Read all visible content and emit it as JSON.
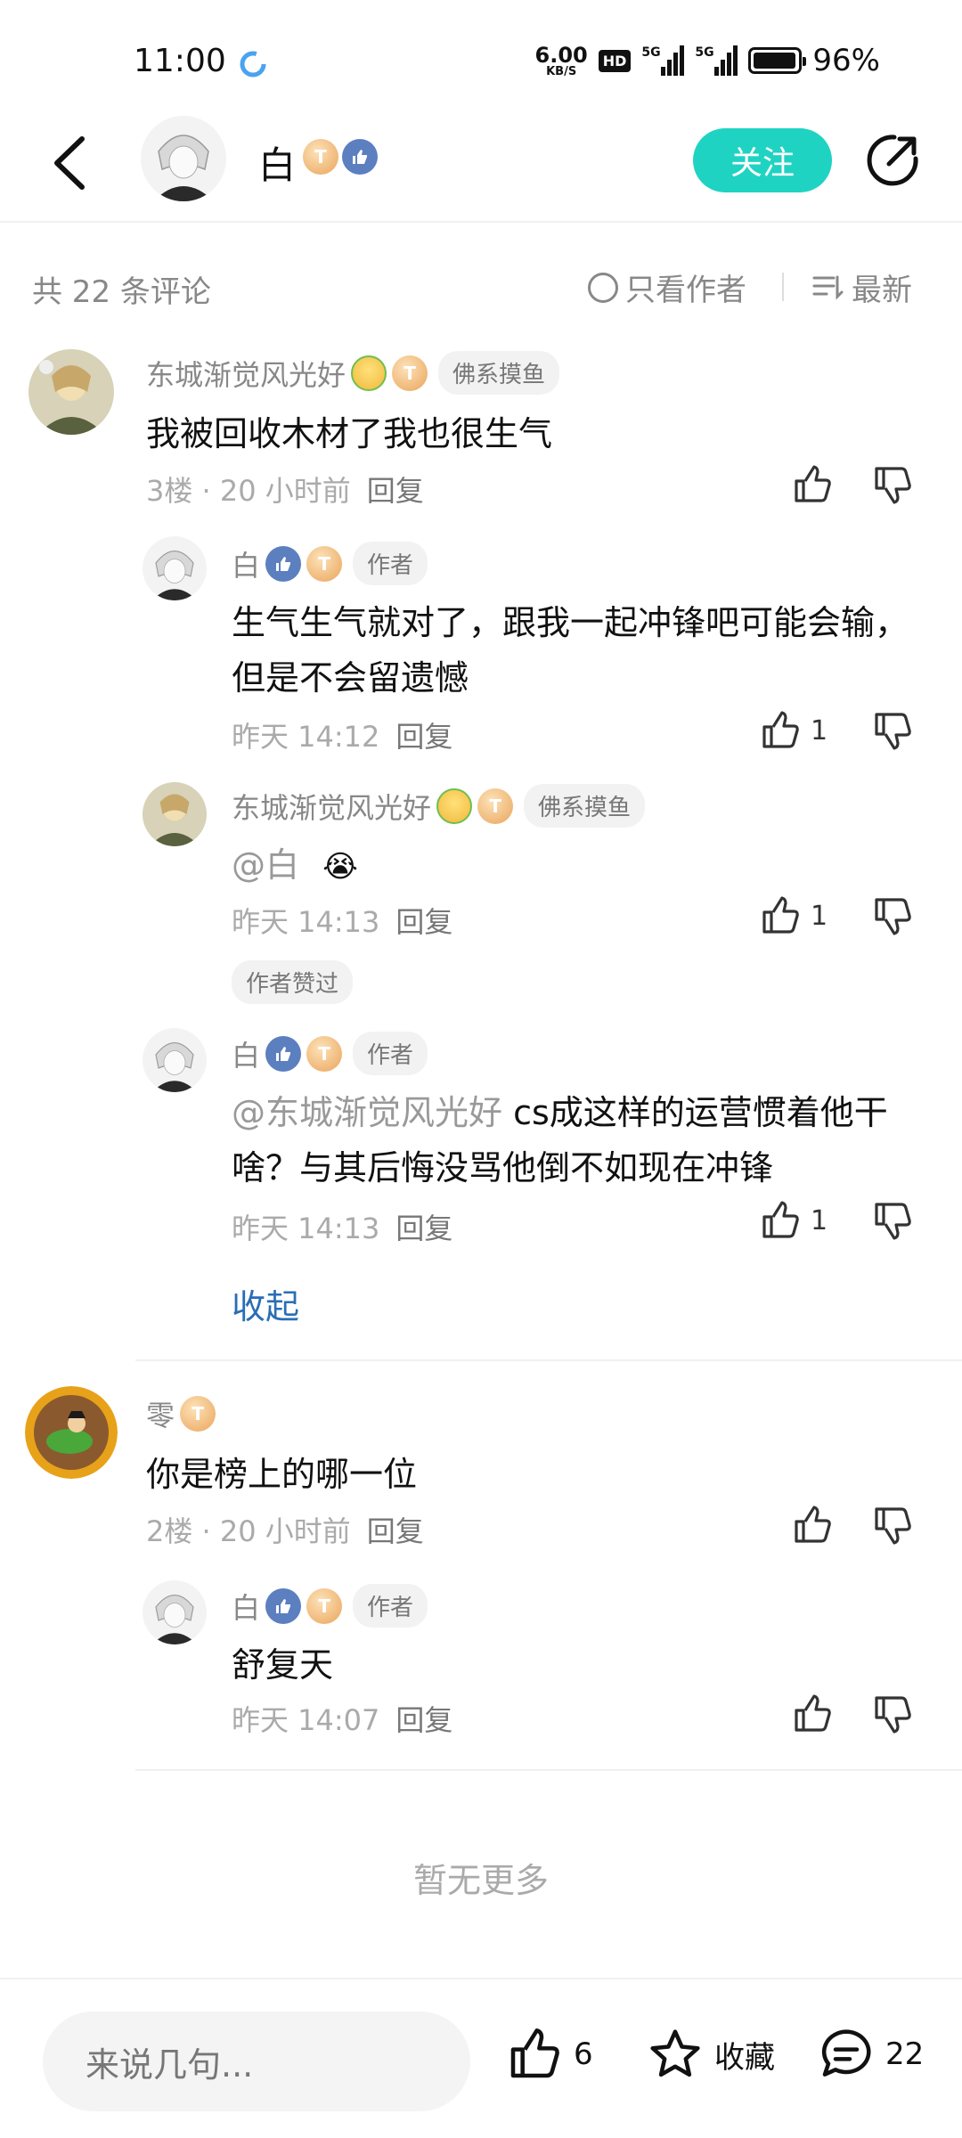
{
  "status": {
    "time": "11:00",
    "net_speed": "6.00",
    "net_unit": "KB/S",
    "hd": "HD",
    "sig1": "5G",
    "sig2": "5G",
    "battery": "96%",
    "battery_level": 0.96
  },
  "header": {
    "name": "白",
    "follow_label": "关注"
  },
  "comments_bar": {
    "count_label": "共 22 条评论",
    "only_author_label": "只看作者",
    "sort_label": "最新"
  },
  "comments": [
    {
      "user": "东城渐觉风光好",
      "level": "5",
      "tag": "佛系摸鱼",
      "text": "我被回收木材了我也很生气",
      "floor": "3楼 · 20 小时前",
      "reply": "回复",
      "replies": [
        {
          "user": "白",
          "level": "4",
          "tag": "作者",
          "text": "生气生气就对了，跟我一起冲锋吧可能会输，但是不会留遗憾",
          "time": "昨天 14:12",
          "reply": "回复",
          "likes": "1"
        },
        {
          "user": "东城渐觉风光好",
          "level": "5",
          "tag": "佛系摸鱼",
          "at": "@白",
          "time": "昨天 14:13",
          "reply": "回复",
          "likes": "1",
          "chip": "作者赞过"
        },
        {
          "user": "白",
          "level": "4",
          "tag": "作者",
          "at": "@东城渐觉风光好",
          "text": "cs成这样的运营惯着他干啥？与其后悔没骂他倒不如现在冲锋",
          "time": "昨天 14:13",
          "reply": "回复",
          "likes": "1"
        }
      ],
      "collapse_label": "收起"
    },
    {
      "user": "零",
      "level": "5",
      "text": "你是榜上的哪一位",
      "floor": "2楼 · 20 小时前",
      "reply": "回复",
      "replies": [
        {
          "user": "白",
          "level": "4",
          "tag": "作者",
          "text": "舒复天",
          "time": "昨天 14:07",
          "reply": "回复"
        }
      ]
    }
  ],
  "no_more": "暂无更多",
  "bottom": {
    "placeholder": "来说几句...",
    "likes": "6",
    "fav_label": "收藏",
    "comments": "22"
  }
}
